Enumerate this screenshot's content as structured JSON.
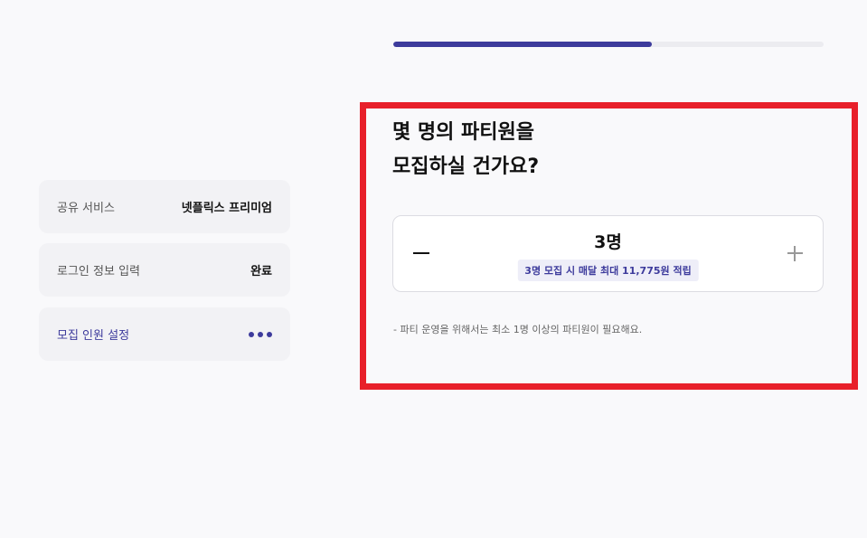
{
  "progress": {
    "fraction": 0.6
  },
  "summary": {
    "items": [
      {
        "label": "공유 서비스",
        "value": "넷플릭스 프리미엄"
      },
      {
        "label": "로그인 정보 입력",
        "value": "완료"
      },
      {
        "label": "모집 인원 설정",
        "value_icon": "more-dots-icon"
      }
    ]
  },
  "question": {
    "line1": "몇 명의 파티원을",
    "line2": "모집하실 건가요?"
  },
  "stepper": {
    "count": "3명",
    "reward": "3명 모집 시 매달 최대 11,775원 적립",
    "minus_icon": "minus-icon",
    "plus_icon": "plus-icon"
  },
  "notice": "- 파티 운영을 위해서는 최소 1명 이상의 파티원이 필요해요.",
  "colors": {
    "accent": "#3d3b9c",
    "highlight": "#e8202a",
    "background": "#f9f9fb"
  }
}
